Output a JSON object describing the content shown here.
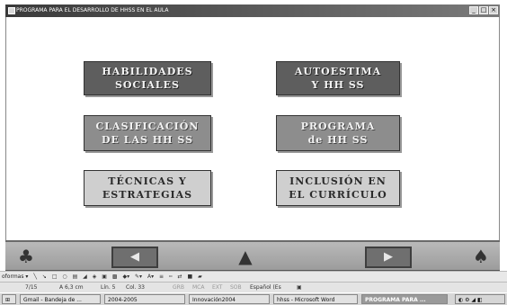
{
  "window": {
    "title": "PROGRAMA PARA EL DESARROLLO DE HHSS EN EL AULA",
    "buttons": [
      "_",
      "□",
      "×"
    ]
  },
  "menu": {
    "habilidades": "HABILIDADES\nSOCIALES",
    "autoestima": "AUTOESTIMA\nY HH SS",
    "clasificacion": "CLASIFICACIÓN\nDE LAS HH SS",
    "programa": "PROGRAMA\nde HH SS",
    "tecnicas": "TÉCNICAS Y\nESTRATEGIAS",
    "inclusion": "INCLUSIÓN EN\nEL CURRÍCULO"
  },
  "nav": {
    "prev_label": "◀",
    "next_label": "▶",
    "icons": [
      "figure-left-icon",
      "witch-hat-icon",
      "figure-right-icon"
    ]
  },
  "drawing_toolbar": {
    "label": "oformas ▾"
  },
  "status": {
    "page": "7/15",
    "position": "A 6,3 cm",
    "line": "Lín. 5",
    "column": "Col. 33",
    "grb": "GRB",
    "mca": "MCA",
    "ext": "EXT",
    "sob": "SOB",
    "language": "Español (Es"
  },
  "taskbar": {
    "items": [
      "Gmail - Bandeja de ...",
      "2004-2005",
      "Innovación2004",
      "hhss - Microsoft Word",
      "PROGRAMA PARA ..."
    ]
  }
}
